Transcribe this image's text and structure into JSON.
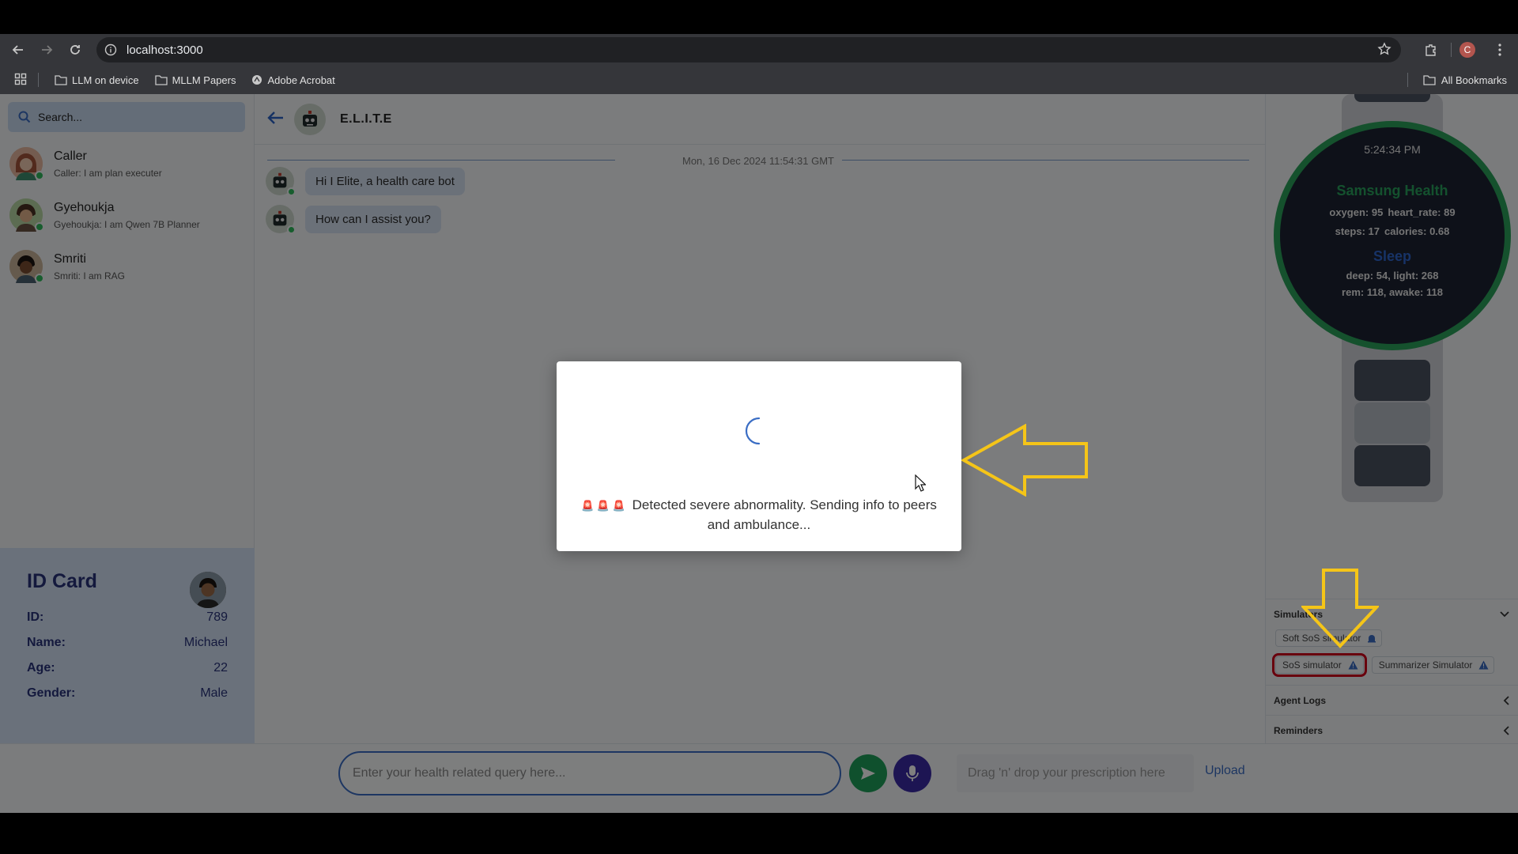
{
  "browser": {
    "url": "localhost:3000",
    "bookmarks": [
      "LLM on device",
      "MLLM Papers",
      "Adobe Acrobat"
    ],
    "all_bookmarks": "All Bookmarks",
    "profile_initial": "C"
  },
  "sidebar": {
    "search_placeholder": "Search...",
    "contacts": [
      {
        "name": "Caller",
        "message": "Caller: I am plan executer"
      },
      {
        "name": "Gyehoukja",
        "message": "Gyehoukja: I am Qwen 7B Planner"
      },
      {
        "name": "Smriti",
        "message": "Smriti: I am RAG"
      }
    ]
  },
  "id_card": {
    "title": "ID Card",
    "rows": [
      {
        "label": "ID:",
        "value": "789"
      },
      {
        "label": "Name:",
        "value": "Michael"
      },
      {
        "label": "Age:",
        "value": "22"
      },
      {
        "label": "Gender:",
        "value": "Male"
      }
    ]
  },
  "chat": {
    "title": "E.L.I.T.E",
    "date": "Mon, 16 Dec 2024 11:54:31 GMT",
    "messages": [
      "Hi I Elite, a health care bot",
      "How can I assist you?"
    ]
  },
  "watch": {
    "time": "5:24:34 PM",
    "health_title": "Samsung Health",
    "oxygen": "oxygen: 95",
    "heart_rate": "heart_rate: 89",
    "steps": "steps: 17",
    "calories": "calories: 0.68",
    "sleep_title": "Sleep",
    "sleep_line1": "deep: 54, light: 268",
    "sleep_line2": "rem: 118, awake: 118"
  },
  "panels": {
    "simulators": "Simulators",
    "soft_sos": "Soft SoS simulator",
    "sos": "SoS simulator",
    "summarizer": "Summarizer Simulator",
    "agent_logs": "Agent Logs",
    "reminders": "Reminders"
  },
  "bottom": {
    "query_placeholder": "Enter your health related query here...",
    "drop_text": "Drag 'n' drop your prescription here",
    "upload": "Upload"
  },
  "modal": {
    "sirens": "🚨 🚨 🚨",
    "message": "Detected severe abnormality. Sending info to peers and ambulance..."
  },
  "colors": {
    "accent_blue": "#3a6dc4",
    "health_green": "#2aa35a",
    "annotation_yellow": "#f5c518",
    "highlight_red": "#d0021b"
  }
}
